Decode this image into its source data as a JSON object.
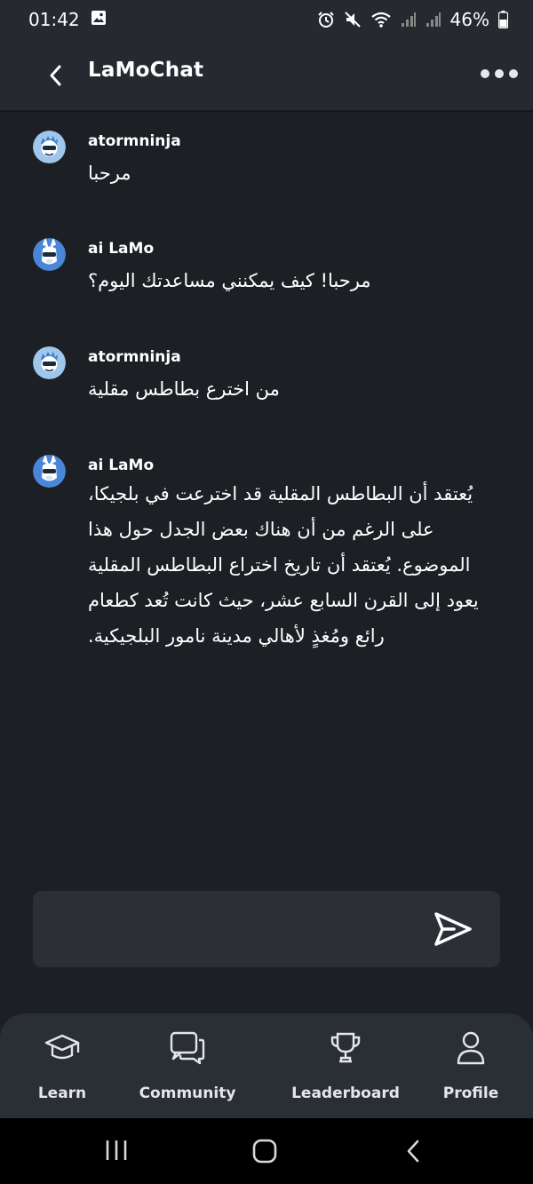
{
  "status_bar": {
    "time": "01:42",
    "battery": "46%"
  },
  "header": {
    "title": "LaMoChat"
  },
  "messages": [
    {
      "sender": "atormninja",
      "avatar": "user-avatar",
      "text": "مرحبا"
    },
    {
      "sender": "ai LaMo",
      "avatar": "llama-bot-avatar",
      "text": "مرحبا! كيف يمكنني مساعدتك اليوم؟"
    },
    {
      "sender": "atormninja",
      "avatar": "user-avatar",
      "text": "من اخترع بطاطس مقلية"
    },
    {
      "sender": "ai LaMo",
      "avatar": "llama-bot-avatar",
      "text": "يُعتقد أن البطاطس المقلية قد اخترعت في بلجيكا، على الرغم من أن هناك بعض الجدل حول هذا الموضوع. يُعتقد أن تاريخ اختراع البطاطس المقلية يعود إلى القرن السابع عشر، حيث كانت تُعد كطعام رائع ومُغذٍ لأهالي مدينة نامور البلجيكية."
    }
  ],
  "composer": {
    "placeholder": ""
  },
  "bottom_nav": [
    {
      "label": "Learn",
      "icon": "graduation-cap-icon"
    },
    {
      "label": "Community",
      "icon": "chat-bubbles-icon"
    },
    {
      "label": "Leaderboard",
      "icon": "trophy-icon"
    },
    {
      "label": "Profile",
      "icon": "person-icon"
    }
  ],
  "colors": {
    "background": "#1c1f24",
    "header": "#262a30",
    "composer": "#2c3036",
    "nav": "#2a2e35",
    "avatar_blue": "#4a86d8"
  }
}
